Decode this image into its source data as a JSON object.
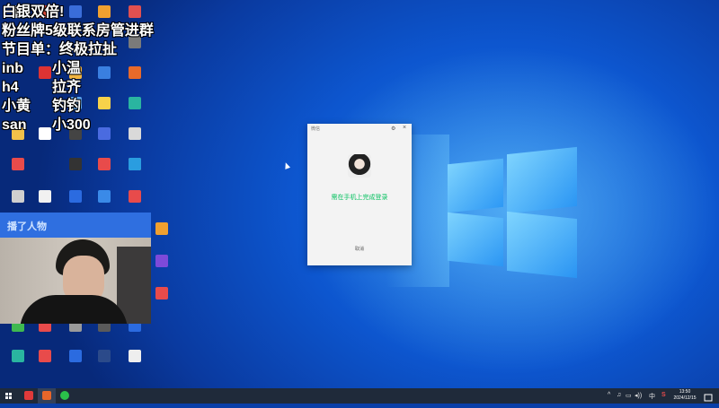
{
  "overlay": {
    "line1": "白银双倍!",
    "line2": "粉丝牌5级联系房管进群",
    "line3": "节目单：终极拉扯",
    "pairs": [
      {
        "left": "inb",
        "right": "小温"
      },
      {
        "left": "h4",
        "right": "拉齐"
      },
      {
        "left": "小黄",
        "right": "钓钓"
      },
      {
        "left": "san",
        "right": "小300"
      }
    ]
  },
  "login_dialog": {
    "title": "微信",
    "settings_icon": "gear-icon",
    "close_icon": "close-icon",
    "message": "需在手机上完成登录",
    "cancel_label": "取消"
  },
  "streamer_banner": "播了人物",
  "desktop_icons": [
    {
      "label": "",
      "color": "#c8c8c8",
      "col": 0,
      "row": 0
    },
    {
      "label": "",
      "color": "#d94a3a",
      "col": 1,
      "row": 0
    },
    {
      "label": "",
      "color": "#3a6dd9",
      "col": 2,
      "row": 0
    },
    {
      "label": "",
      "color": "#f0a030",
      "col": 3,
      "row": 0
    },
    {
      "label": "",
      "color": "#e05050",
      "col": 4,
      "row": 0
    },
    {
      "label": "",
      "color": "#7a7a7a",
      "col": 4,
      "row": 1
    },
    {
      "label": "",
      "color": "#d33",
      "col": 1,
      "row": 2
    },
    {
      "label": "",
      "color": "#f1b440",
      "col": 2,
      "row": 2
    },
    {
      "label": "",
      "color": "#3a7fe0",
      "col": 3,
      "row": 2
    },
    {
      "label": "",
      "color": "#e86a2a",
      "col": 4,
      "row": 2
    },
    {
      "label": "",
      "color": "#5aa0e8",
      "col": 2,
      "row": 3
    },
    {
      "label": "",
      "color": "#f7d24a",
      "col": 3,
      "row": 3
    },
    {
      "label": "",
      "color": "#2ab5a0",
      "col": 4,
      "row": 3
    },
    {
      "label": "",
      "color": "#f2c14a",
      "col": 0,
      "row": 4
    },
    {
      "label": "",
      "color": "#ffffff",
      "col": 1,
      "row": 4
    },
    {
      "label": "",
      "color": "#444",
      "col": 2,
      "row": 4
    },
    {
      "label": "",
      "color": "#4a6be0",
      "col": 3,
      "row": 4
    },
    {
      "label": "",
      "color": "#d9d9d9",
      "col": 4,
      "row": 4
    },
    {
      "label": "",
      "color": "#e84b4b",
      "col": 0,
      "row": 5
    },
    {
      "label": "",
      "color": "#333",
      "col": 2,
      "row": 5
    },
    {
      "label": "",
      "color": "#e84b4b",
      "col": 3,
      "row": 5
    },
    {
      "label": "",
      "color": "#f5c542",
      "col": 4,
      "row": 5
    },
    {
      "label": "",
      "color": "#2a9de0",
      "col": 4,
      "row": 5.0
    },
    {
      "label": "",
      "color": "#cfcfcf",
      "col": 0,
      "row": 6
    },
    {
      "label": "",
      "color": "#f1f1f1",
      "col": 1,
      "row": 6
    },
    {
      "label": "",
      "color": "#2b6be0",
      "col": 2,
      "row": 6
    },
    {
      "label": "",
      "color": "#3a8ae8",
      "col": 3,
      "row": 6
    },
    {
      "label": "",
      "color": "#e84b4b",
      "col": 4,
      "row": 6
    },
    {
      "label": "",
      "color": "#f0a030",
      "col": 5,
      "row": 7
    },
    {
      "label": "",
      "color": "#7d4ad9",
      "col": 5,
      "row": 8
    },
    {
      "label": "",
      "color": "#e84b4b",
      "col": 5,
      "row": 9
    },
    {
      "label": "",
      "color": "#3fb950",
      "col": 0,
      "row": 10
    },
    {
      "label": "",
      "color": "#e84b4b",
      "col": 1,
      "row": 10
    },
    {
      "label": "",
      "color": "#9a9a9a",
      "col": 2,
      "row": 10
    },
    {
      "label": "",
      "color": "#5a5a5a",
      "col": 3,
      "row": 10
    },
    {
      "label": "",
      "color": "#2b6be0",
      "col": 4,
      "row": 10
    },
    {
      "label": "",
      "color": "#2ab5a0",
      "col": 0,
      "row": 11
    },
    {
      "label": "",
      "color": "#e84b4b",
      "col": 1,
      "row": 11
    },
    {
      "label": "",
      "color": "#2b6be0",
      "col": 2,
      "row": 11
    },
    {
      "label": "",
      "color": "#2b4a8a",
      "col": 3,
      "row": 11
    },
    {
      "label": "",
      "color": "#eeeeee",
      "col": 4,
      "row": 11
    }
  ],
  "taskbar": {
    "start_icon": "windows-start-icon",
    "apps": [
      {
        "icon": "wps-icon",
        "color": "#e03a3a"
      },
      {
        "icon": "app-orange-icon",
        "color": "#e8662a"
      },
      {
        "icon": "wechat-icon",
        "color": "#2ac14a"
      }
    ],
    "tray_symbols": [
      "^",
      "♫",
      "▭",
      "◂))",
      "中",
      "S"
    ],
    "time": "13:50",
    "date": "2024/12/15"
  }
}
